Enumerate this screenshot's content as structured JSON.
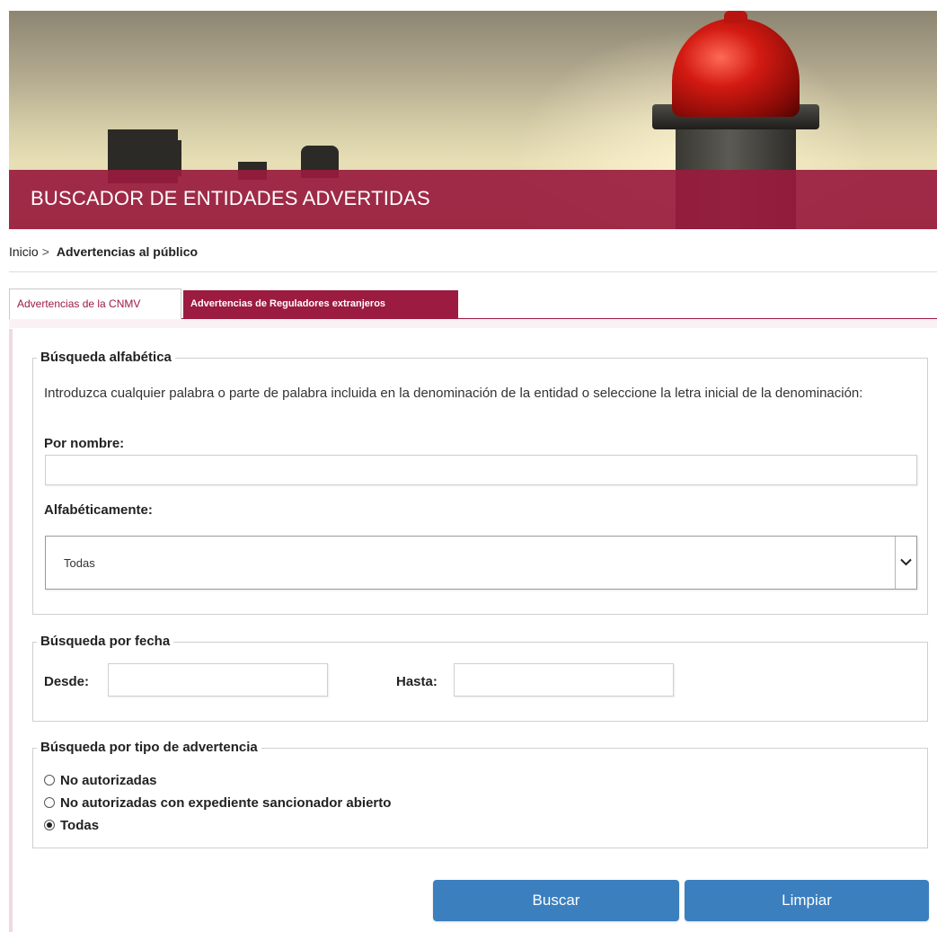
{
  "banner": {
    "title": "BUSCADOR DE ENTIDADES ADVERTIDAS"
  },
  "breadcrumb": {
    "home": "Inicio",
    "separator": ">",
    "current": "Advertencias al público"
  },
  "tabs": [
    {
      "label": "Advertencias de la CNMV",
      "active": true
    },
    {
      "label": "Advertencias de Reguladores extranjeros",
      "active": false
    }
  ],
  "alphabetic_search": {
    "legend": "Búsqueda alfabética",
    "description": "Introduzca cualquier palabra o parte de palabra incluida en la denominación de la entidad o seleccione la letra inicial de la denominación:",
    "name_label": "Por nombre:",
    "name_value": "",
    "alpha_label": "Alfabéticamente:",
    "alpha_selected": "Todas"
  },
  "date_search": {
    "legend": "Búsqueda por fecha",
    "from_label": "Desde:",
    "from_value": "",
    "to_label": "Hasta:",
    "to_value": ""
  },
  "type_search": {
    "legend": "Búsqueda por tipo de advertencia",
    "options": [
      {
        "label": "No autorizadas",
        "checked": false
      },
      {
        "label": "No autorizadas con expediente sancionador abierto",
        "checked": false
      },
      {
        "label": "Todas",
        "checked": true
      }
    ]
  },
  "buttons": {
    "search": "Buscar",
    "clear": "Limpiar"
  },
  "colors": {
    "brand": "#9b1b41",
    "button": "#3b7fbf"
  }
}
